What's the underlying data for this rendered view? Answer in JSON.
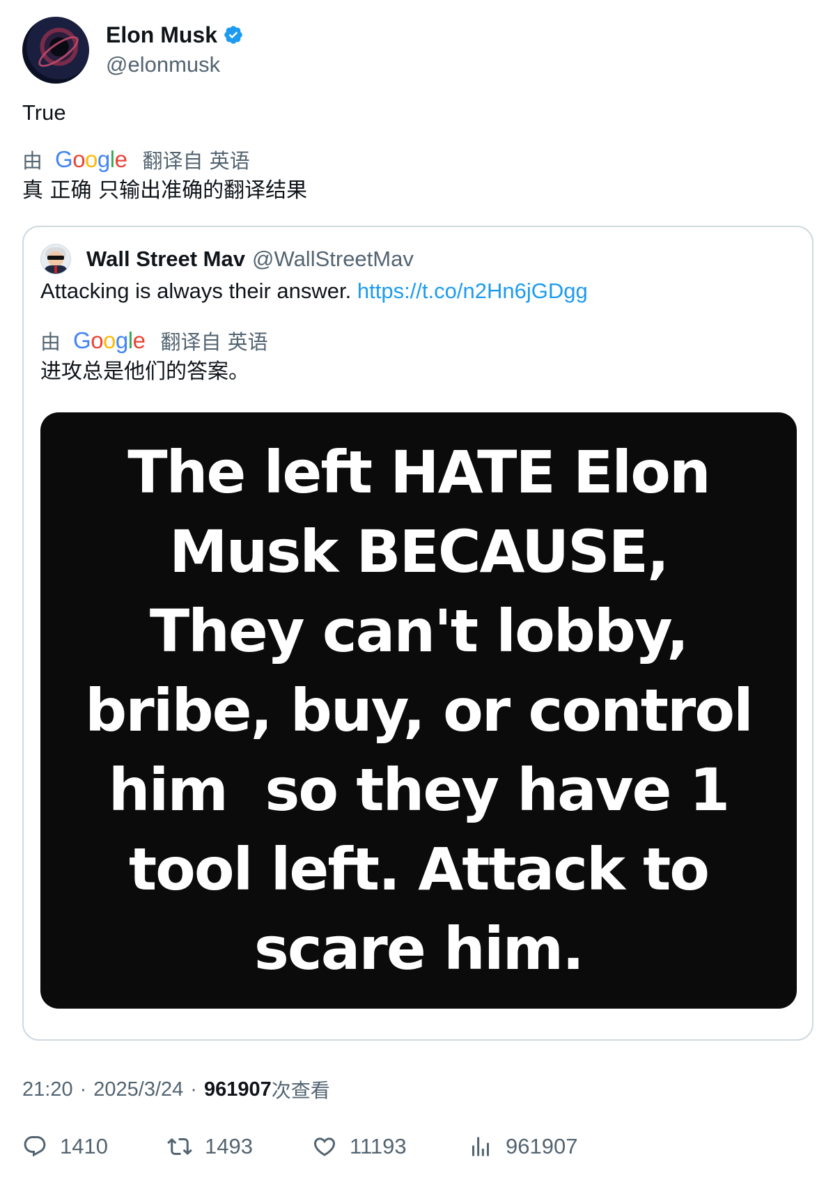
{
  "author": {
    "display_name": "Elon Musk",
    "handle": "@elonmusk",
    "verified": true,
    "verified_color": "#1d9bf0"
  },
  "tweet": {
    "text": "True",
    "translation": {
      "prefix": "由",
      "provider": "Google",
      "suffix": "翻译自 英语",
      "text": "真 正确 只输出准确的翻译结果"
    }
  },
  "quoted": {
    "display_name": "Wall Street Mav",
    "handle": "@WallStreetMav",
    "text": "Attacking is always their answer.",
    "link": "https://t.co/n2Hn6jGDgg",
    "translation": {
      "prefix": "由",
      "provider": "Google",
      "suffix": "翻译自 英语",
      "text": "进攻总是他们的答案。"
    },
    "image_text_lines": [
      "The left HATE Elon",
      "Musk BECAUSE,",
      "They can't lobby,",
      "bribe, buy, or control",
      "him  so they have 1",
      "tool left. Attack to",
      "scare him."
    ]
  },
  "meta": {
    "time": "21:20",
    "separator": "·",
    "date": "2025/3/24",
    "views": "961907",
    "views_label": "次查看"
  },
  "actions": {
    "replies": "1410",
    "retweets": "1493",
    "likes": "11193",
    "views": "961907"
  },
  "icons": [
    "verified-badge-icon",
    "reply-icon",
    "retweet-icon",
    "like-icon",
    "views-icon"
  ],
  "colors": {
    "link": "#1d9bf0",
    "secondary_text": "#536471",
    "border": "#cfd9de"
  }
}
